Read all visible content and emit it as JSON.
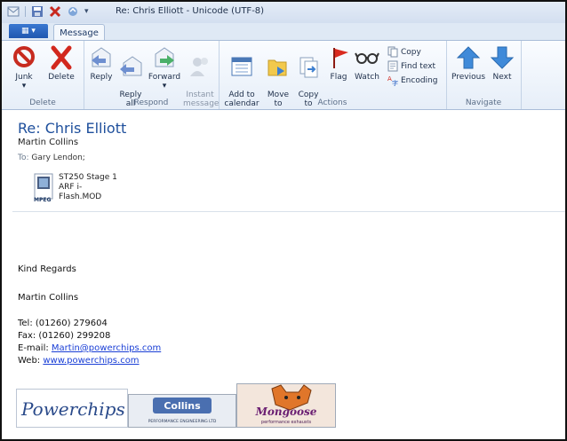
{
  "window": {
    "title": "Re: Chris Elliott - Unicode (UTF-8)"
  },
  "tabs": {
    "file_label": "▦ ▾",
    "message": "Message"
  },
  "ribbon": {
    "delete_group": {
      "label": "Delete",
      "junk": "Junk",
      "junk_arrow": "▾",
      "delete": "Delete"
    },
    "respond_group": {
      "label": "Respond",
      "reply": "Reply",
      "reply_all": "Reply\nall",
      "forward": "Forward",
      "forward_arrow": "▾",
      "instant_message": "Instant\nmessage"
    },
    "actions_group": {
      "label": "Actions",
      "add_to_calendar": "Add to\ncalendar",
      "move_to": "Move\nto",
      "copy_to": "Copy\nto",
      "flag": "Flag",
      "watch": "Watch",
      "copy": "Copy",
      "find_text": "Find text",
      "encoding": "Encoding"
    },
    "navigate_group": {
      "label": "Navigate",
      "previous": "Previous",
      "next": "Next"
    }
  },
  "message": {
    "subject": "Re: Chris Elliott",
    "sender": "Martin Collins",
    "to_label": "To:",
    "to_value": "Gary Lendon;",
    "attachment": {
      "name": "ST250 Stage 1\nARF i-\nFlash.MOD",
      "type": "MPEG"
    }
  },
  "body": {
    "regards": "Kind Regards",
    "signature_name": "Martin Collins",
    "tel": "Tel: (01260) 279604",
    "fax": "Fax: (01260) 299208",
    "email_label": "E-mail: ",
    "email": "Martin@powerchips.com",
    "web_label": "Web: ",
    "web": "www.powerchips.com"
  },
  "logos": {
    "powerchips": "Powerchips",
    "collins": "Collins",
    "collins_sub": "PERFORMANCE ENGINEERING LTD",
    "mongoose": "Mongoose",
    "mongoose_sub": "performance exhausts"
  }
}
